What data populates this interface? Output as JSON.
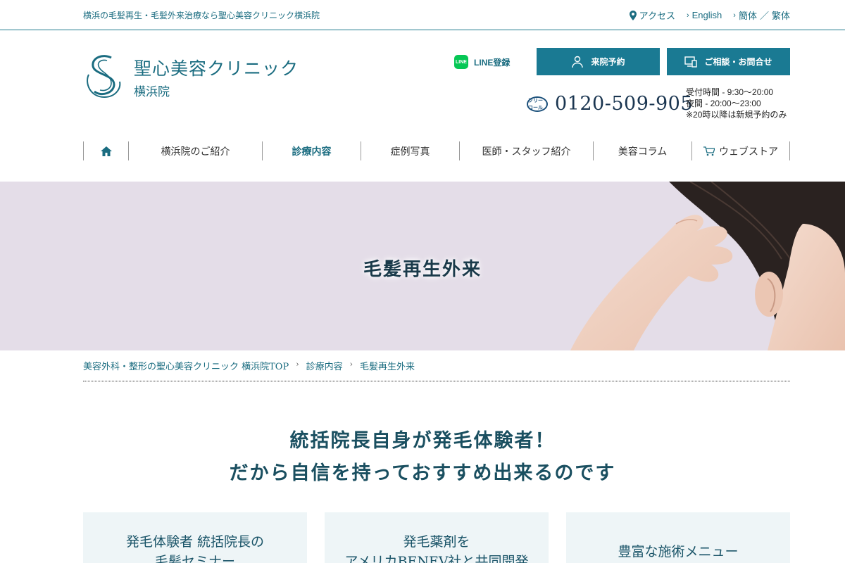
{
  "topbar": {
    "tagline": "横浜の毛髪再生・毛髪外来治療なら聖心美容クリニック横浜院",
    "access": "アクセス",
    "english": "English",
    "simplified": "簡体",
    "divider": "／",
    "traditional": "繁体"
  },
  "logo": {
    "name": "聖心美容クリニック",
    "branch": "横浜院"
  },
  "header": {
    "line_label": "LINE登録",
    "line_icon_text": "LINE",
    "reserve_label": "来院予約",
    "contact_label": "ご相談・お問合せ",
    "free_call_text": "フリーコール",
    "phone": "0120-509-905",
    "hours_day": "受付時間 - 9:30〜20:00",
    "hours_night": "夜間 - 20:00〜23:00",
    "hours_note": "※20時以降は新規予約のみ"
  },
  "nav": {
    "items": [
      {
        "label": "横浜院のご紹介"
      },
      {
        "label": "診療内容"
      },
      {
        "label": "症例写真"
      },
      {
        "label": "医師・スタッフ紹介"
      },
      {
        "label": "美容コラム"
      },
      {
        "label": "ウェブストア"
      }
    ]
  },
  "hero": {
    "title": "毛髪再生外来"
  },
  "breadcrumb": {
    "items": [
      "美容外科・整形の聖心美容クリニック 横浜院TOP",
      "診療内容",
      "毛髪再生外来"
    ]
  },
  "headline": {
    "line1": "統括院長自身が発毛体験者！",
    "line2": "だから自信を持っておすすめ出来るのです"
  },
  "cards": [
    {
      "line1": "発毛体験者 統括院長の",
      "line2": "毛髪セミナー"
    },
    {
      "line1": "発毛薬剤を",
      "line2": "アメリカBENEV社と共同開発"
    },
    {
      "line1": "豊富な施術メニュー"
    }
  ],
  "colors": {
    "brand": "#1a6c80",
    "cta": "#1a7a93",
    "hero_bg": "#e4dde8",
    "card_bg": "#eef5f7",
    "line_green": "#06c755"
  }
}
